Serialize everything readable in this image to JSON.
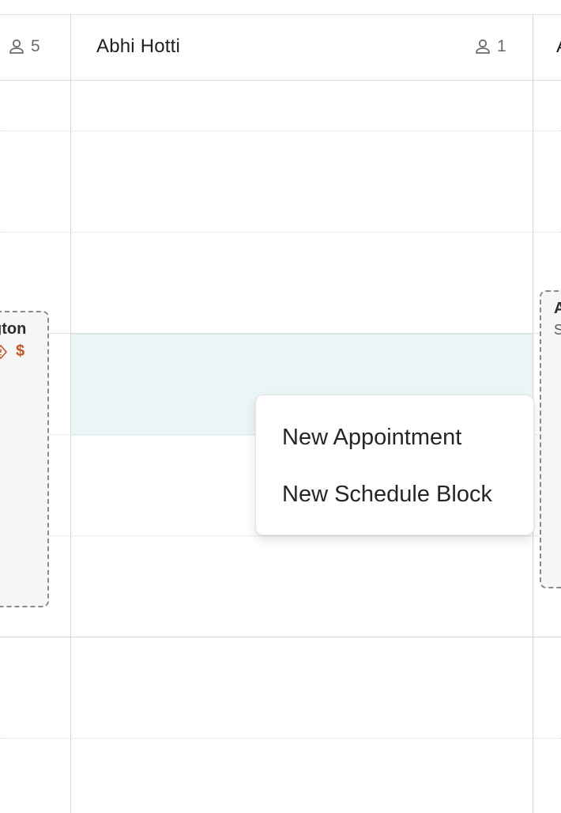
{
  "header": {
    "left_column": {
      "count": "5"
    },
    "main_column": {
      "title": "Abhi Hotti",
      "count": "1"
    },
    "right_column": {
      "title": "A"
    }
  },
  "appointments": {
    "left": {
      "name_fragment": "gton",
      "dollar": "$"
    },
    "right": {
      "name_fragment": "A",
      "sub_fragment": "S"
    }
  },
  "context_menu": {
    "items": [
      {
        "label": "New Appointment"
      },
      {
        "label": "New Schedule Block"
      }
    ]
  },
  "icons": {
    "count": "person-icon",
    "appointment_status": "diamond-warning-icon"
  },
  "colors": {
    "highlight": "#eaf5f8",
    "accent": "#c4552a",
    "grid": "#d6d6d6"
  }
}
